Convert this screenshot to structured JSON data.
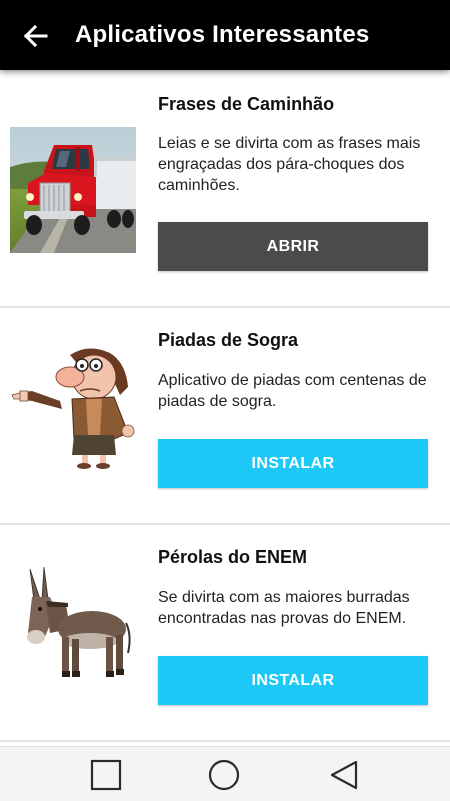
{
  "app_bar": {
    "back_icon": "arrow-left-icon",
    "title": "Aplicativos Interessantes"
  },
  "apps": [
    {
      "name": "Frases de Caminhão",
      "description": "Leias e se divirta com as frases mais engraçadas dos pára-choques dos caminhões.",
      "button_label": "ABRIR",
      "button_state": "open",
      "thumbnail": "red-truck-photo"
    },
    {
      "name": "Piadas de Sogra",
      "description": "Aplicativo de piadas com centenas de piadas de sogra.",
      "button_label": "INSTALAR",
      "button_state": "install",
      "thumbnail": "mother-in-law-cartoon"
    },
    {
      "name": "Pérolas do ENEM",
      "description": "Se divirta com as maiores burradas encontradas nas provas do ENEM.",
      "button_label": "INSTALAR",
      "button_state": "install",
      "thumbnail": "donkey-photo"
    }
  ],
  "nav_bar": {
    "recents_icon": "square-recents-icon",
    "home_icon": "circle-home-icon",
    "back_icon": "triangle-back-icon"
  },
  "colors": {
    "app_bar": "#000000",
    "open_button": "#4b4b4b",
    "install_button": "#1ec8f6"
  }
}
